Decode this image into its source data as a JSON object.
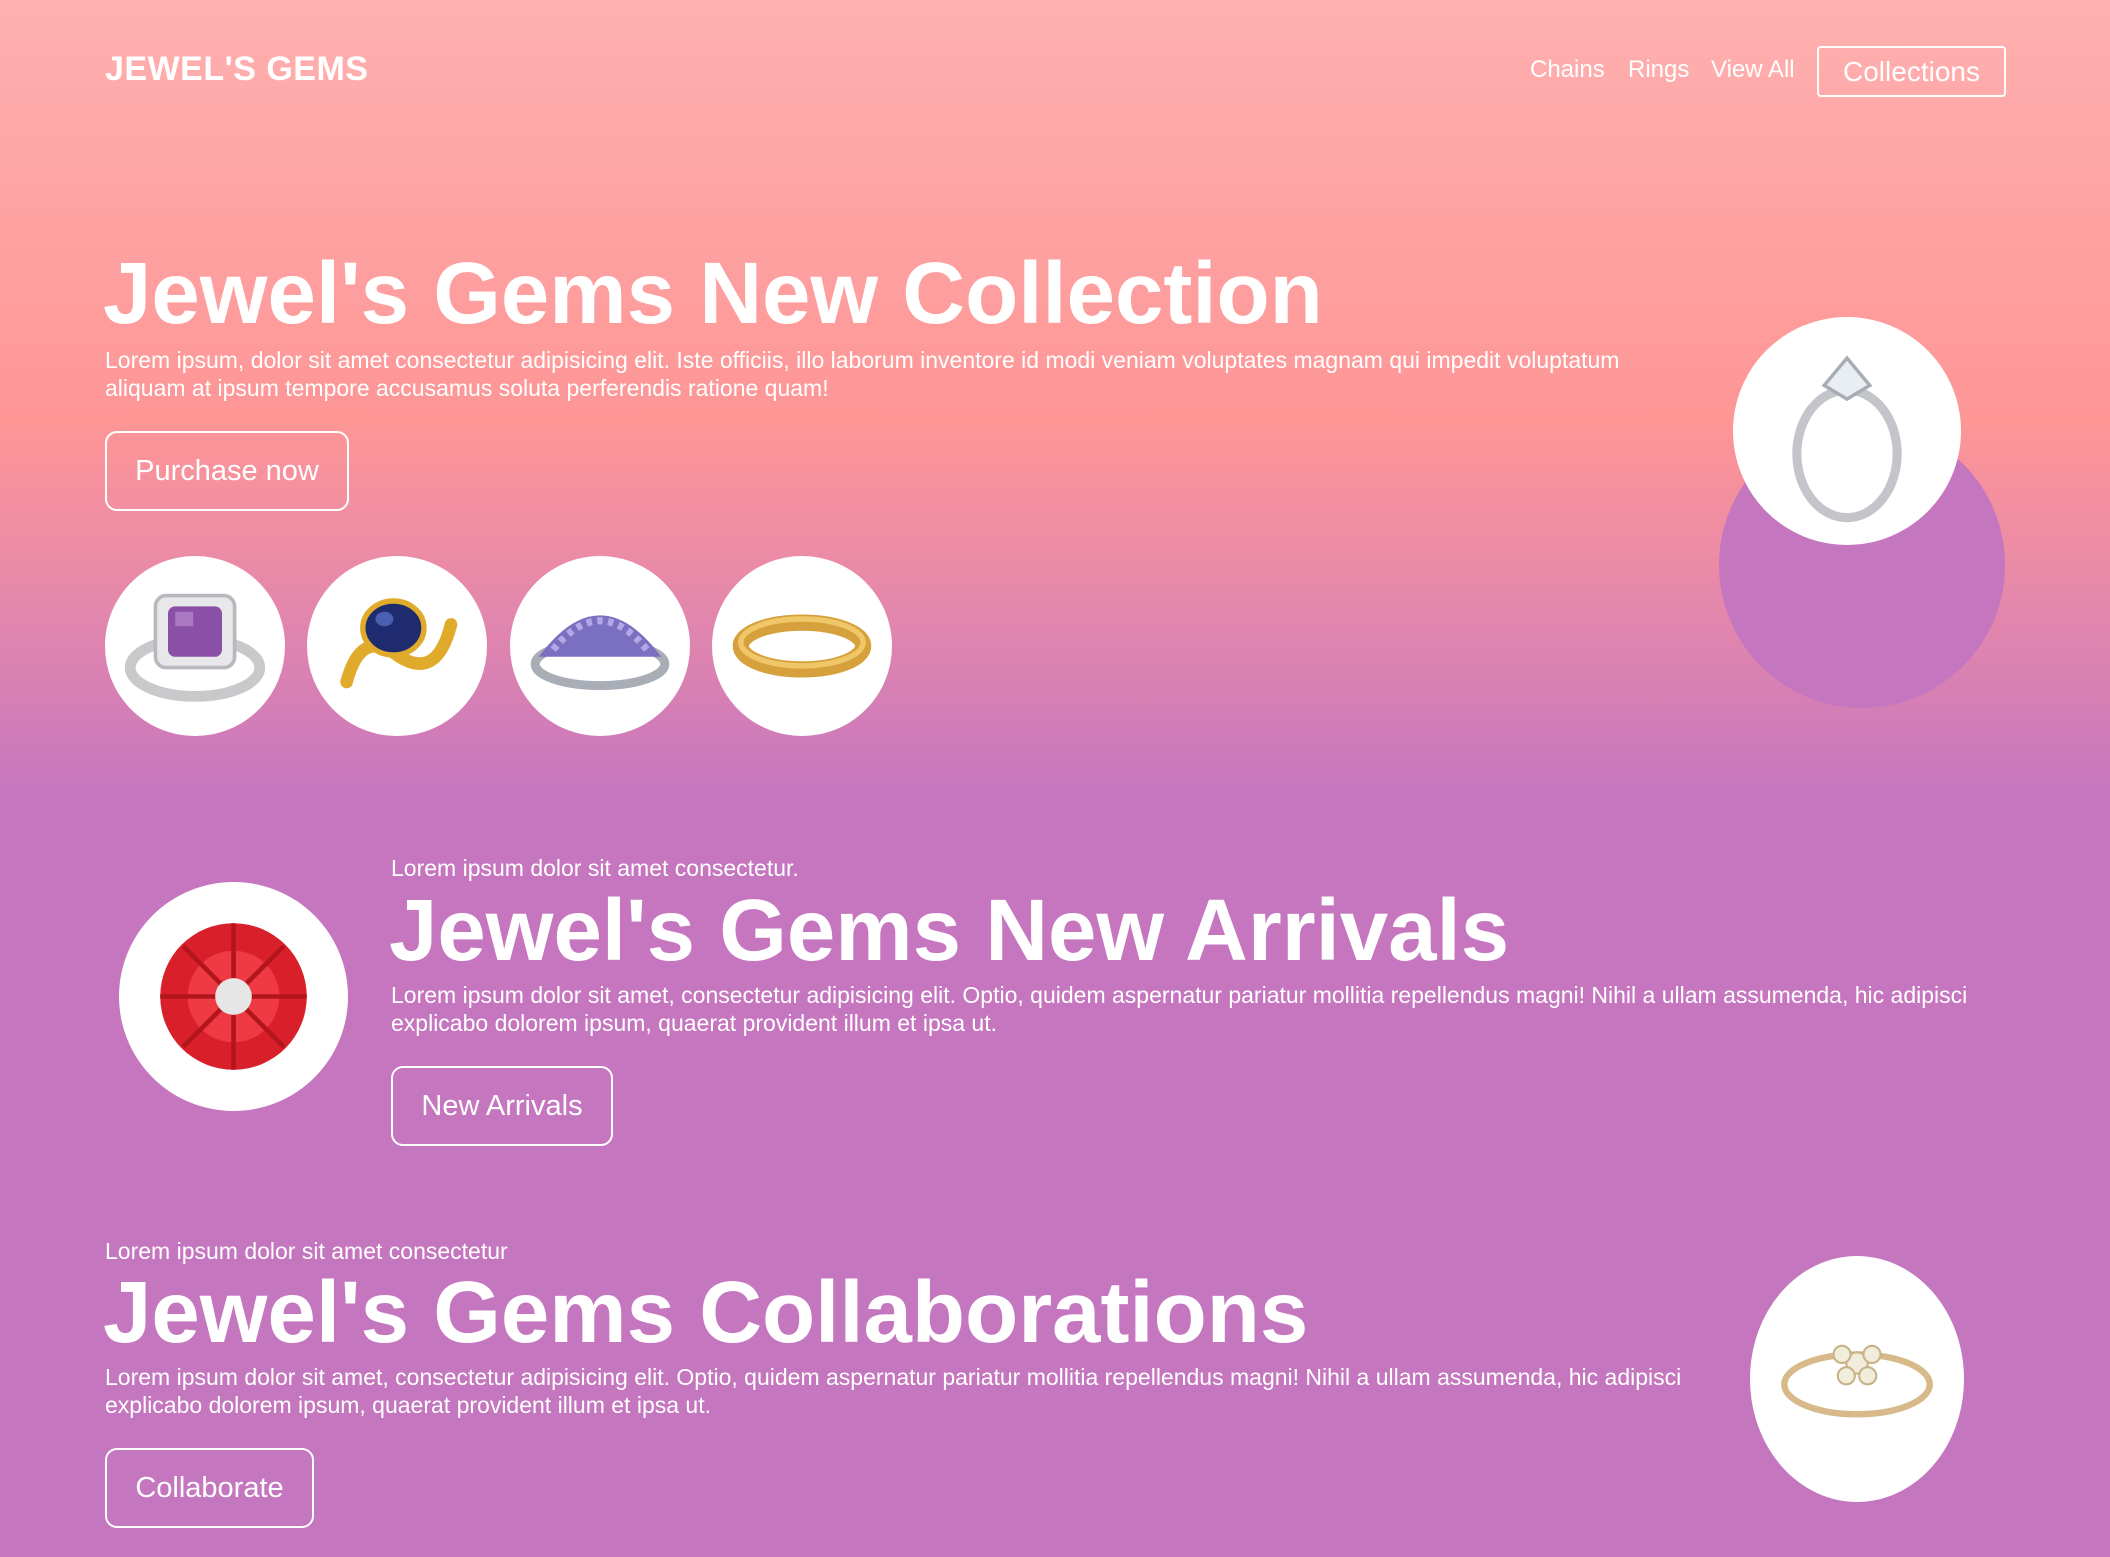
{
  "nav": {
    "brand": "JEWEL'S GEMS",
    "links": [
      "Chains",
      "Rings",
      "View All"
    ],
    "collections_label": "Collections"
  },
  "hero": {
    "title": "Jewel's Gems New Collection",
    "description": "Lorem ipsum, dolor sit amet consectetur adipisicing elit. Iste officiis, illo laborum inventore id modi veniam voluptates magnam qui impedit voluptatum aliquam at ipsum tempore accusamus soluta perferendis ratione quam!",
    "button_label": "Purchase now",
    "thumbnails": [
      "amethyst-ring-icon",
      "sapphire-ring-icon",
      "pave-band-icon",
      "gold-band-icon"
    ],
    "feature_image": "solitaire-ring-icon"
  },
  "arrivals": {
    "kicker": "Lorem ipsum dolor sit amet consectetur.",
    "title": "Jewel's Gems New Arrivals",
    "description": "Lorem ipsum dolor sit amet, consectetur adipisicing elit. Optio, quidem aspernatur pariatur mollitia repellendus magni! Nihil a ullam assumenda, hic adipisci explicabo dolorem ipsum, quaerat provident illum et ipsa ut.",
    "button_label": "New Arrivals",
    "image": "red-flower-ring-icon"
  },
  "collabs": {
    "kicker": "Lorem ipsum dolor sit amet consectetur",
    "title": "Jewel's Gems Collaborations",
    "description": "Lorem ipsum dolor sit amet, consectetur adipisicing elit. Optio, quidem aspernatur pariatur mollitia repellendus magni! Nihil a ullam assumenda, hic adipisci explicabo dolorem ipsum, quaerat provident illum et ipsa ut.",
    "button_label": "Collaborate",
    "image": "flower-band-icon"
  },
  "colors": {
    "gradient_top": "#ffb0b0",
    "gradient_mid": "#fe9696",
    "purple": "#c476be",
    "text": "#ffffff"
  }
}
